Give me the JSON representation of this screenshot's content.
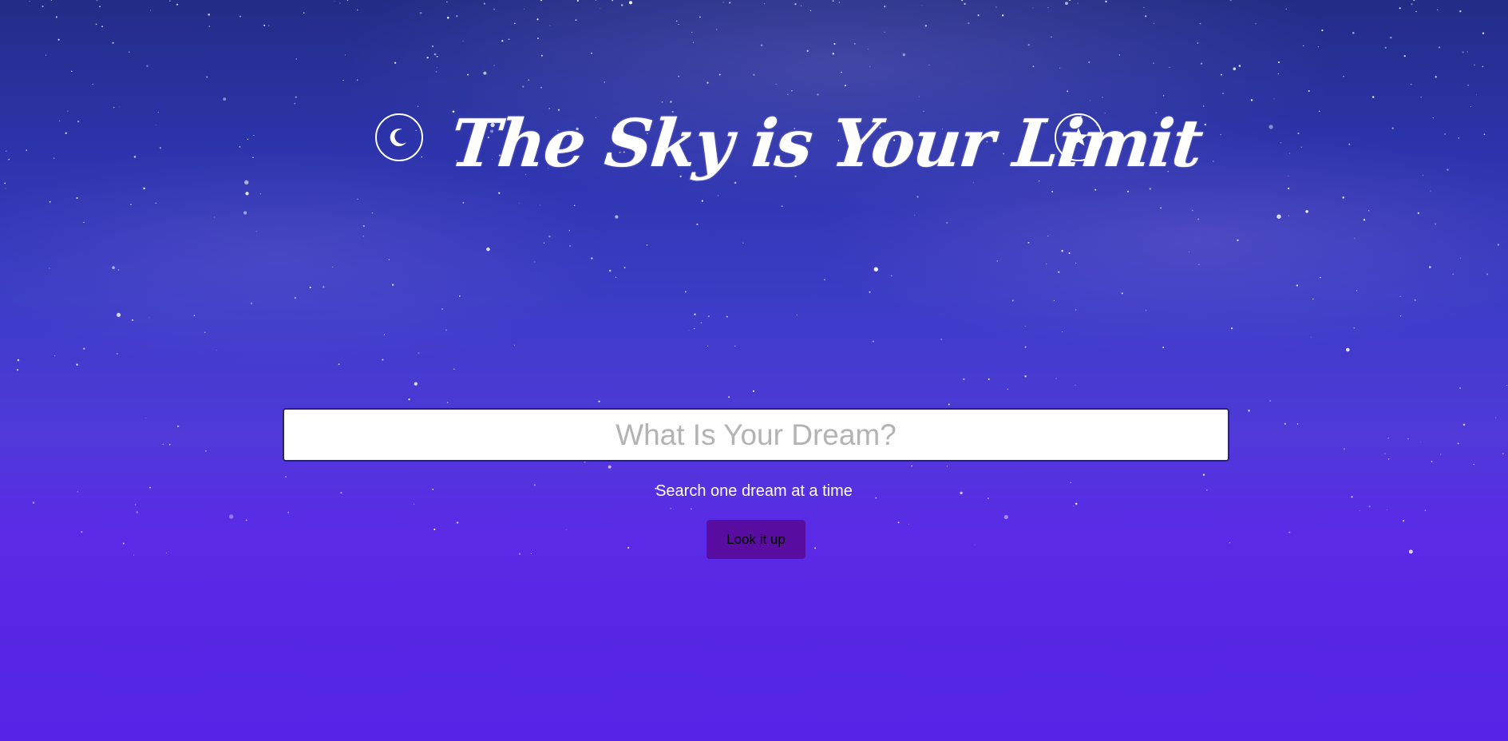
{
  "header": {
    "title": "The Sky is Your Limit",
    "left_icon": "moon-icon",
    "right_icon": "star-icon"
  },
  "search": {
    "placeholder": "What Is Your Dream?",
    "value": "",
    "hint": "Search one dream at a time",
    "button_label": "Look it up"
  },
  "colors": {
    "background_top": "#232d86",
    "background_bottom": "#5524e6",
    "button": "#5a0ea1",
    "text": "#ffffff"
  }
}
